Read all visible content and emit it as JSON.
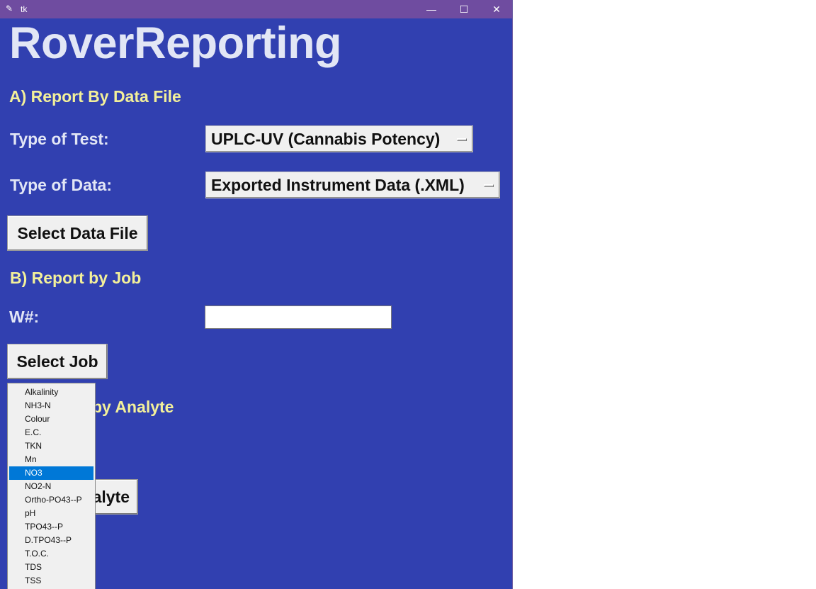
{
  "titlebar": {
    "title": "tk",
    "icon": "feather-icon",
    "minimize": "—",
    "maximize": "☐",
    "close": "✕"
  },
  "app": {
    "title": "RoverReporting"
  },
  "section_a": {
    "heading": "A) Report By Data File",
    "test_label": "Type of Test:",
    "test_value": "UPLC-UV (Cannabis Potency)",
    "data_label": "Type of Data:",
    "data_value": "Exported Instrument Data (.XML)",
    "select_button": "Select Data File"
  },
  "section_b": {
    "heading": "B) Report by Job",
    "w_label": "W#:",
    "w_value": "",
    "select_button": "Select Job"
  },
  "section_c": {
    "heading_visible": "by Analyte",
    "button_visible": "alyte"
  },
  "dropdown": {
    "selected": "NO3",
    "items": [
      "Alkalinity",
      "NH3-N",
      "Colour",
      "E.C.",
      "TKN",
      "Mn",
      "NO3",
      "NO2-N",
      "Ortho-PO43--P",
      "pH",
      "TPO43--P",
      "D.TPO43--P",
      "T.O.C.",
      "TDS",
      "TSS"
    ]
  },
  "colors": {
    "window_bg": "#3140b0",
    "titlebar_bg": "#6f4ca0",
    "section_text": "#f3f09a",
    "label_text": "#e2e6f5",
    "selection": "#0078d7"
  }
}
